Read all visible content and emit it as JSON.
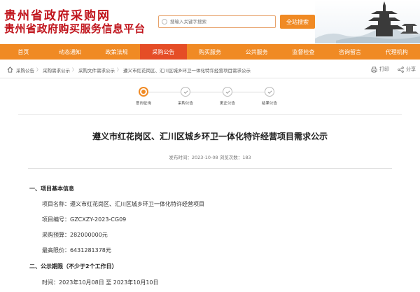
{
  "header": {
    "title_line1": "贵州省政府采购网",
    "title_line2": "贵州省政府购买服务信息平台",
    "search_placeholder": "搜输入关键字搜索",
    "search_button": "全站搜索"
  },
  "nav": {
    "items": [
      {
        "label": "首页",
        "active": false
      },
      {
        "label": "动态通知",
        "active": false
      },
      {
        "label": "政策法规",
        "active": false
      },
      {
        "label": "采购公告",
        "active": true
      },
      {
        "label": "购买服务",
        "active": false
      },
      {
        "label": "公共服务",
        "active": false
      },
      {
        "label": "监督检查",
        "active": false
      },
      {
        "label": "咨询留言",
        "active": false
      },
      {
        "label": "代理机构",
        "active": false
      }
    ]
  },
  "breadcrumb": {
    "items": [
      "采购公告",
      "采购需求公示",
      "采购文件需求公示",
      "遵义市红花岗区、汇川区城乡环卫一体化特许经营项目需求公示"
    ],
    "print_label": "打印",
    "share_label": "分享"
  },
  "steps": {
    "items": [
      {
        "label": "意向征询",
        "active": true
      },
      {
        "label": "采购公告",
        "active": false
      },
      {
        "label": "更正公告",
        "active": false
      },
      {
        "label": "结果公告",
        "active": false
      }
    ]
  },
  "article": {
    "title": "遵义市红花岗区、汇川区城乡环卫一体化特许经营项目需求公示",
    "meta": "发布时间：2023-10-08    浏览次数：183",
    "section1": "一、项目基本信息",
    "project_name": "项目名称：遵义市红花岗区、汇川区城乡环卫一体化特许经营项目",
    "project_no": "项目编号：GZCXZY-2023-CG09",
    "budget": "采购预算：282000000元",
    "max_price": "最高限价：6431281378元",
    "section2": "二、公示期限（不少于2个工作日）",
    "period": "时间：2023年10月08日 至 2023年10月10日"
  },
  "colors": {
    "brand_red": "#c0131b",
    "nav_orange": "#f08a24",
    "nav_active": "#e54d26"
  }
}
